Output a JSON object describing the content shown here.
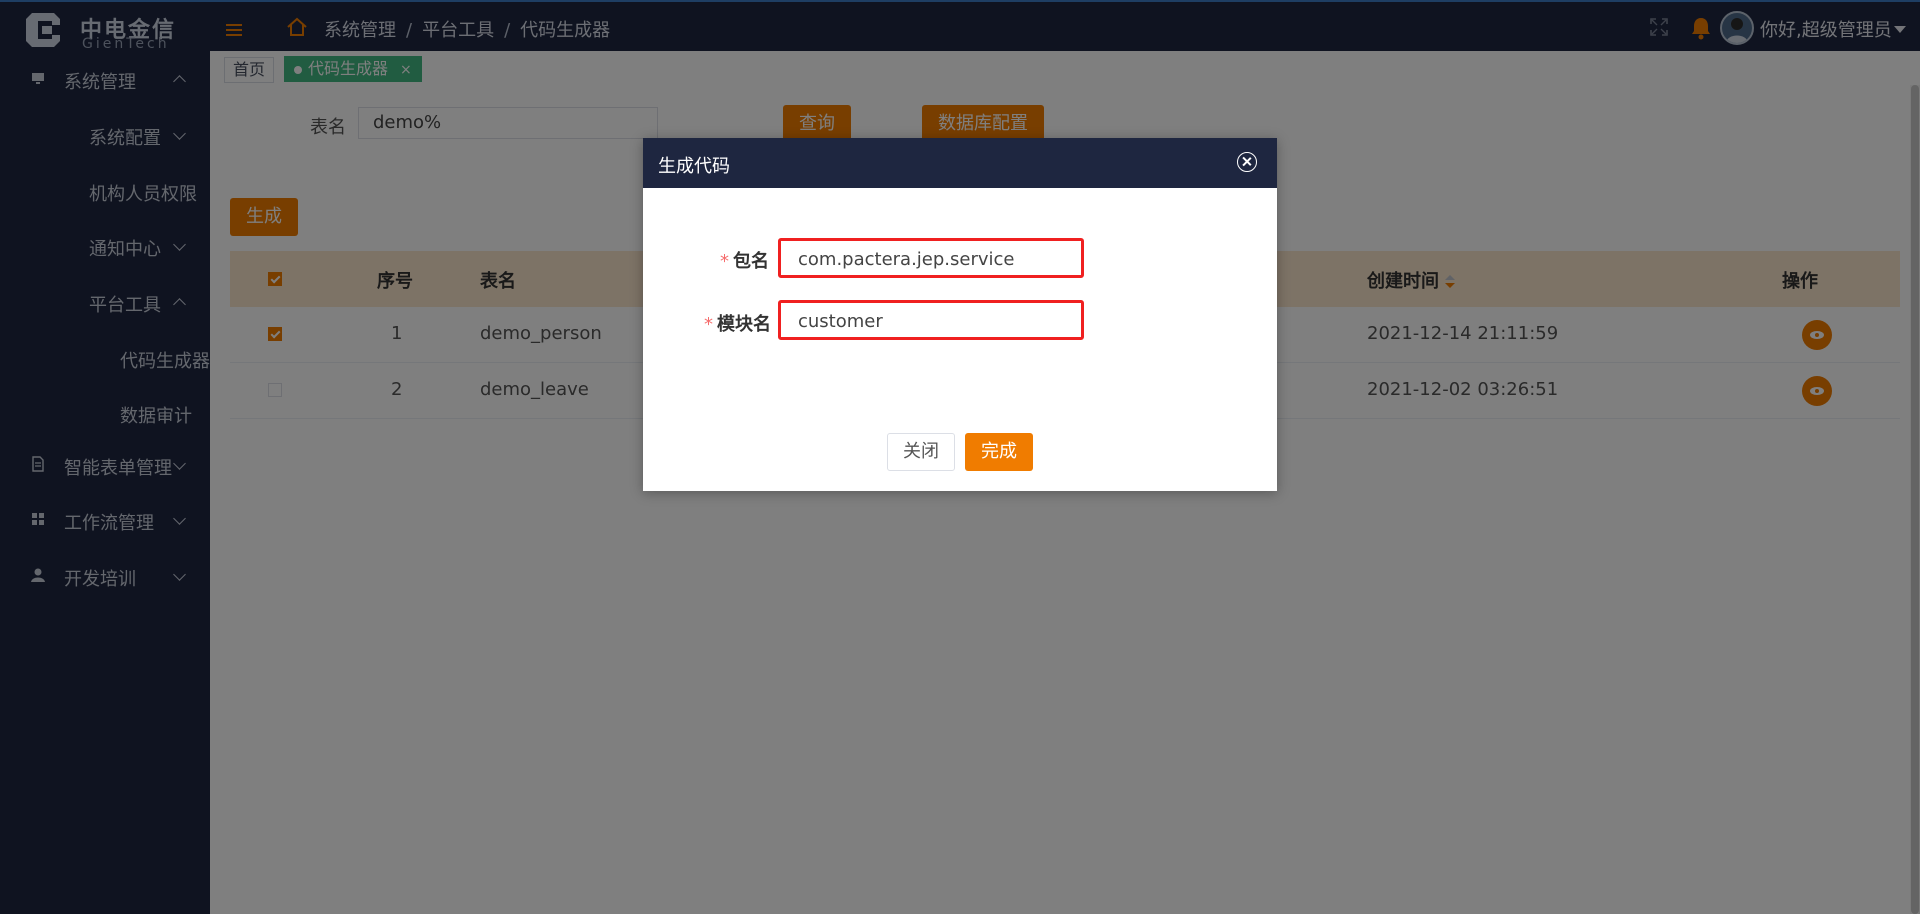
{
  "app": {
    "logo_cn": "中电金信",
    "logo_en": "GienTech"
  },
  "header": {
    "breadcrumb": [
      "系统管理",
      "平台工具",
      "代码生成器"
    ],
    "greeting": "你好,超级管理员"
  },
  "sidebar": {
    "items": [
      {
        "label": "系统管理",
        "icon": "monitor-icon",
        "expanded": true
      },
      {
        "label": "系统配置"
      },
      {
        "label": "机构人员权限"
      },
      {
        "label": "通知中心"
      },
      {
        "label": "平台工具",
        "expanded": true
      },
      {
        "label": "代码生成器"
      },
      {
        "label": "数据审计"
      },
      {
        "label": "智能表单管理",
        "icon": "document-icon"
      },
      {
        "label": "工作流管理",
        "icon": "grid-icon"
      },
      {
        "label": "开发培训",
        "icon": "user-icon"
      }
    ]
  },
  "tabs": {
    "home": "首页",
    "active": "代码生成器",
    "close": "×"
  },
  "query": {
    "label": "表名",
    "value": "demo%",
    "query_button": "查询",
    "db_config_button": "数据库配置",
    "generate_button": "生成"
  },
  "table": {
    "headers": [
      "序号",
      "表名",
      "创建时间",
      "操作"
    ],
    "rows": [
      {
        "index": "1",
        "name": "demo_person",
        "created": "2021-12-14 21:11:59",
        "checked": true
      },
      {
        "index": "2",
        "name": "demo_leave",
        "created": "2021-12-02 03:26:51",
        "checked": false
      }
    ]
  },
  "dialog": {
    "title": "生成代码",
    "required_mark": "*",
    "package_label": "包名",
    "package_value": "com.pactera.jep.service",
    "module_label": "模块名",
    "module_value": "customer",
    "close_button": "关闭",
    "done_button": "完成"
  },
  "colors": {
    "accent": "#f07c00",
    "nav_bg": "#1e2640",
    "tab_active": "#42b983",
    "highlight_border": "#f02020"
  }
}
